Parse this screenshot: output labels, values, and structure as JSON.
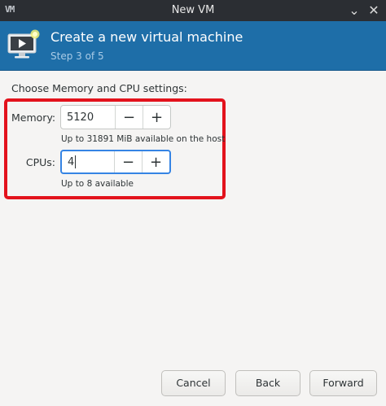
{
  "window": {
    "title": "New VM",
    "app_icon_label": "VM",
    "minimize_glyph": "⌄",
    "close_glyph": "✕"
  },
  "header": {
    "title": "Create a new virtual machine",
    "step": "Step 3 of 5",
    "icon": "vm-monitor-play-icon"
  },
  "settings": {
    "prompt": "Choose Memory and CPU settings:",
    "memory": {
      "label": "Memory:",
      "value": "5120",
      "hint": "Up to 31891 MiB available on the host"
    },
    "cpus": {
      "label": "CPUs:",
      "value": "4",
      "hint": "Up to 8 available"
    },
    "decrement_glyph": "−",
    "increment_glyph": "+"
  },
  "buttons": {
    "cancel": "Cancel",
    "back": "Back",
    "forward": "Forward"
  },
  "colors": {
    "banner": "#1e6ea8",
    "highlight": "#e3121c",
    "focus": "#3584e4"
  }
}
